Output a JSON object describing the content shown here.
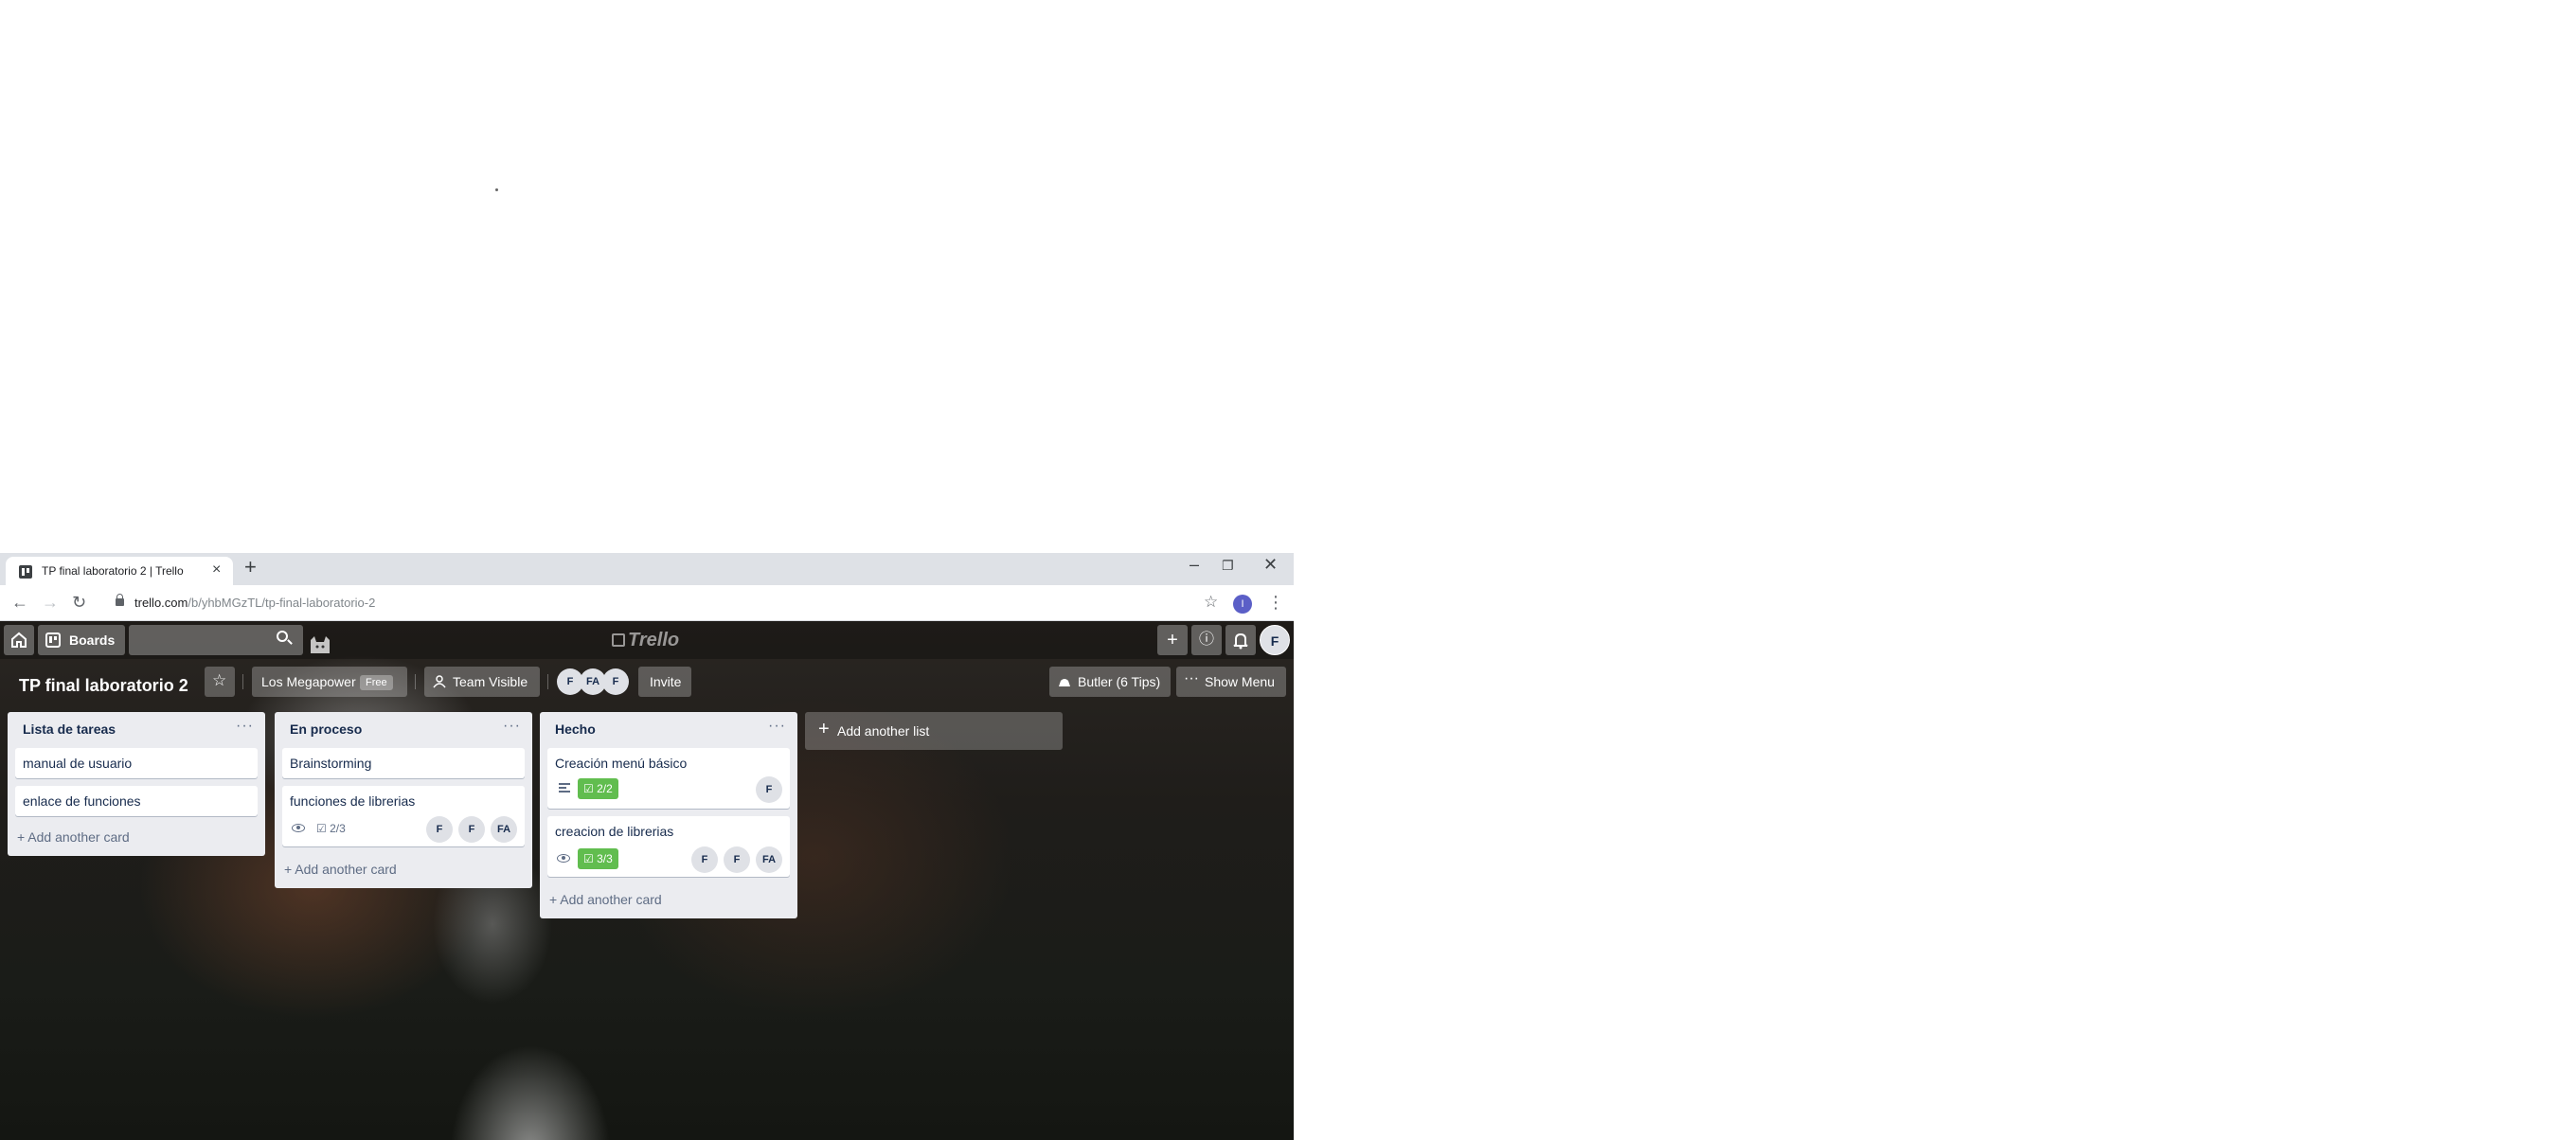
{
  "browser": {
    "tab_title": "TP final laboratorio 2 | Trello",
    "url_host": "trello.com",
    "url_path": "/b/yhbMGzTL/tp-final-laboratorio-2",
    "profile_initial": "I"
  },
  "header": {
    "boards_label": "Boards",
    "logo_text": "Trello",
    "user_initial": "F"
  },
  "board": {
    "title": "TP final laboratorio 2",
    "team_name": "Los Megapower",
    "team_badge": "Free",
    "visibility_label": "Team Visible",
    "members": [
      "F",
      "FA",
      "F"
    ],
    "invite_label": "Invite",
    "butler_label": "Butler (6 Tips)",
    "show_menu_label": "Show Menu"
  },
  "lists": [
    {
      "title": "Lista de tareas",
      "cards": [
        {
          "title": "manual de usuario"
        },
        {
          "title": "enlace de funciones"
        }
      ],
      "add_card_label": "Add another card"
    },
    {
      "title": "En proceso",
      "cards": [
        {
          "title": "Brainstorming"
        },
        {
          "title": "funciones de librerias",
          "checklist": "2/3",
          "members": [
            "F",
            "F",
            "FA"
          ]
        }
      ],
      "add_card_label": "Add another card"
    },
    {
      "title": "Hecho",
      "cards": [
        {
          "title": "Creación menú básico",
          "checklist": "2/2",
          "members": [
            "F"
          ]
        },
        {
          "title": "creacion de librerias",
          "checklist": "3/3",
          "members": [
            "F",
            "F",
            "FA"
          ]
        }
      ],
      "add_card_label": "Add another card"
    }
  ],
  "add_list_label": "Add another list",
  "colors": {
    "checklist_done": "#61bd4f",
    "list_bg": "#ebecf0",
    "text_dark": "#172b4d"
  }
}
